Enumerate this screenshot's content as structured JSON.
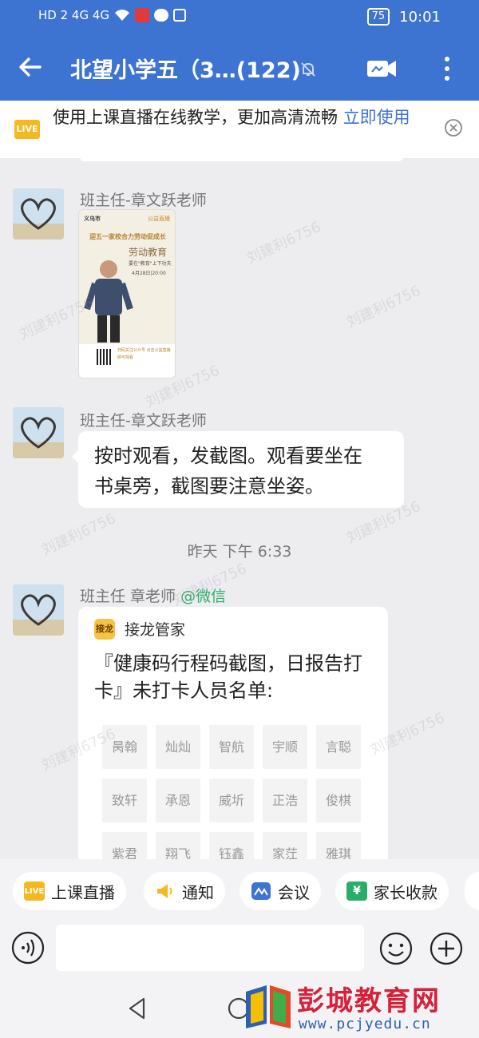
{
  "status_bar": {
    "left_indicators": "HD 2  4G  4G",
    "time": "10:01",
    "battery": "75"
  },
  "header": {
    "title": "北望小学五（3…(122)"
  },
  "live_banner": {
    "badge": "LIVE",
    "text": "使用上课直播在线教学，更加高清流畅 ",
    "link": "立即使用"
  },
  "messages": [
    {
      "sender": "班主任-章文跃老师",
      "type": "image",
      "poster": {
        "brand": "义乌市",
        "tag": "公益直播",
        "headline": "迎五一家校合力劳动促成长",
        "subject": "劳动教育",
        "subtitle": "要在\"教育\"上下功夫",
        "date": "4月28日|20:00",
        "footer": "扫码关注公众号 点击公益直播即可观看"
      }
    },
    {
      "sender": "班主任-章文跃老师",
      "type": "text",
      "text_line1": "按时观看，发截图。观看要坐在",
      "text_line2": "书桌旁，截图要注意坐姿。"
    },
    {
      "sender": "班主任 章老师",
      "sender_tag": "@微信",
      "type": "solitaire",
      "app_icon": "接龙",
      "app_name": "接龙管家",
      "title": "『健康码行程码截图，日报告打卡』未打卡人员名单:",
      "names": [
        "昺翰",
        "灿灿",
        "智航",
        "宇顺",
        "言聪",
        "致轩",
        "承恩",
        "威圻",
        "正浩",
        "俊棋",
        "紫君",
        "翔飞",
        "钰鑫",
        "家茳",
        "雅琪"
      ]
    }
  ],
  "time_separator": "昨天 下午 6:33",
  "quick_actions": [
    {
      "label": "上课直播",
      "icon": "live-icon",
      "icon_text": "LIVE",
      "color": "#f6b821"
    },
    {
      "label": "通知",
      "icon": "megaphone-icon",
      "color": "#f6b821"
    },
    {
      "label": "会议",
      "icon": "meeting-icon",
      "color": "#3d73d1"
    },
    {
      "label": "家长收款",
      "icon": "yuan-icon",
      "icon_text": "¥",
      "color": "#2aae67"
    }
  ],
  "input": {
    "placeholder": ""
  },
  "watermark": "刘建利6756",
  "site": {
    "name": "彭城教育网",
    "url": "www.pcjyedu.cn"
  },
  "colors": {
    "brand_blue": "#3d73d1",
    "wechat_green": "#2aae67",
    "live_yellow": "#f6b821"
  }
}
